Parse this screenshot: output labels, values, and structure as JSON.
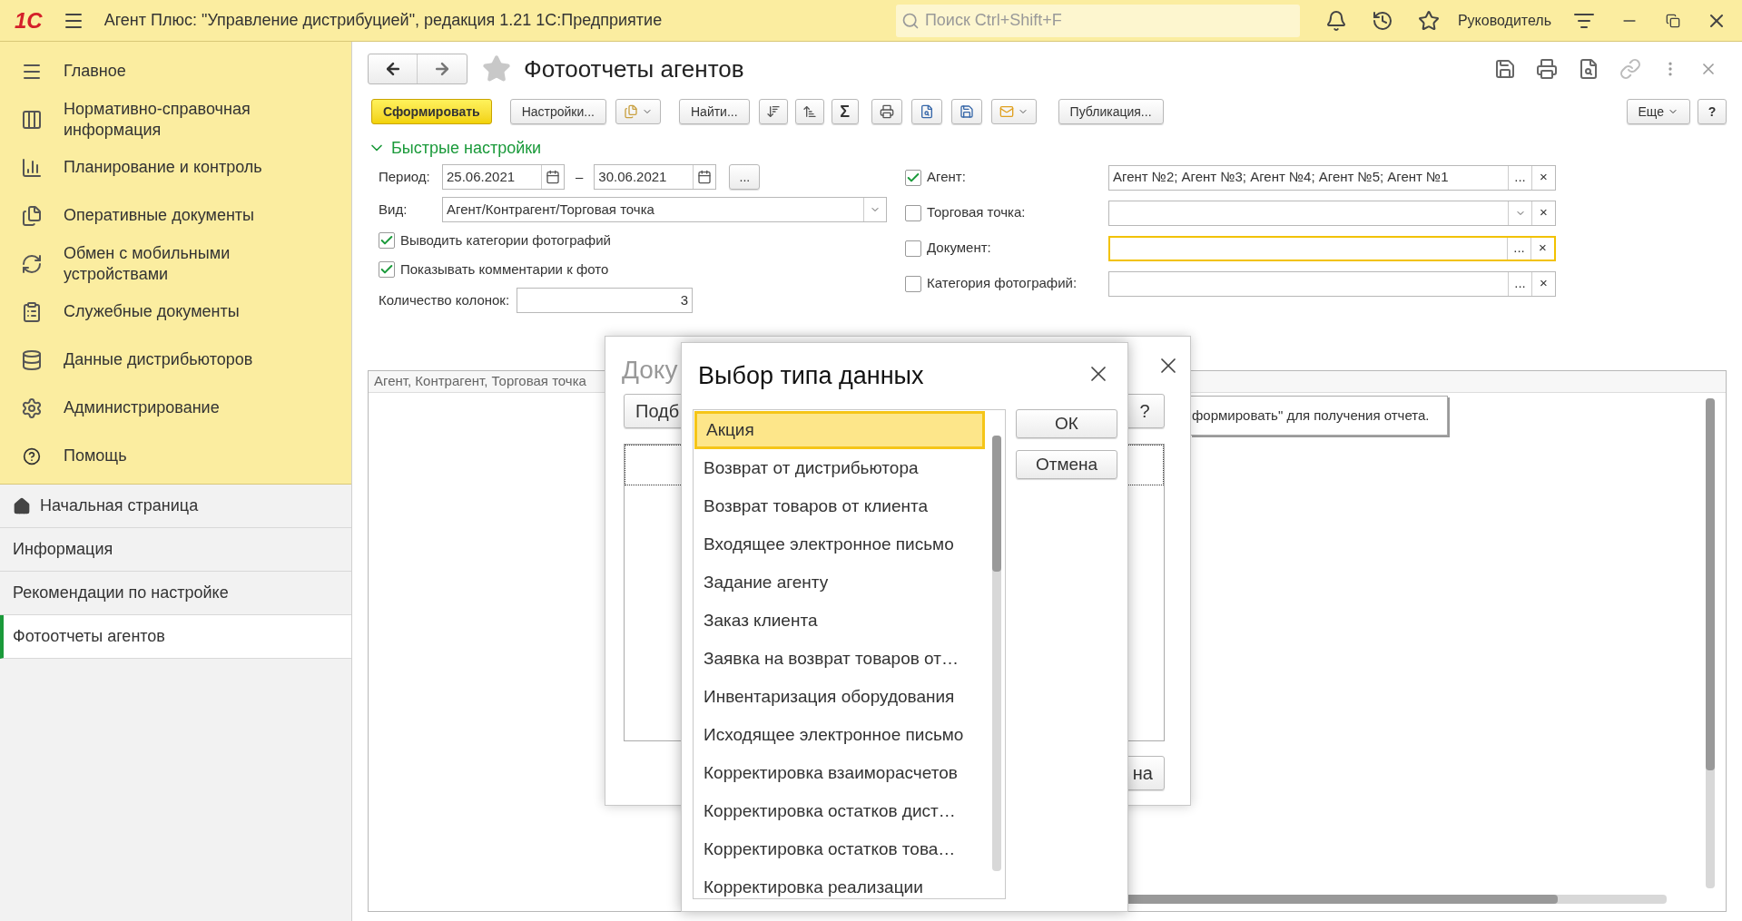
{
  "app_bar": {
    "logo": "1С",
    "title": "Агент Плюс: \"Управление дистрибуцией\", редакция 1.21 1С:Предприятие",
    "search": {
      "placeholder": "Поиск Ctrl+Shift+F"
    },
    "user": "Руководитель"
  },
  "sections": [
    {
      "label": "Главное"
    },
    {
      "label": "Нормативно-справочная информация"
    },
    {
      "label": "Планирование и контроль"
    },
    {
      "label": "Оперативные документы"
    },
    {
      "label": "Обмен с мобильными устройствами"
    },
    {
      "label": "Служебные документы"
    },
    {
      "label": "Данные дистрибьюторов"
    },
    {
      "label": "Администрирование"
    },
    {
      "label": "Помощь"
    }
  ],
  "open_pages": [
    {
      "label": "Начальная страница",
      "kind": "home",
      "selected": false
    },
    {
      "label": "Информация",
      "kind": "page",
      "selected": false
    },
    {
      "label": "Рекомендации по настройке",
      "kind": "page",
      "selected": false
    },
    {
      "label": "Фотоотчеты агентов",
      "kind": "page",
      "selected": true
    }
  ],
  "form": {
    "title": "Фотоотчеты агентов",
    "toolbar": [
      {
        "kind": "primary",
        "label": "Сформировать"
      },
      {
        "kind": "text",
        "label": "Настройки..."
      },
      {
        "kind": "variants"
      },
      {
        "kind": "text",
        "label": "Найти..."
      },
      {
        "kind": "sort-desc"
      },
      {
        "kind": "sort-asc"
      },
      {
        "kind": "text-icon",
        "label": "Σ"
      },
      {
        "kind": "print"
      },
      {
        "kind": "preview"
      },
      {
        "kind": "save"
      },
      {
        "kind": "mail"
      },
      {
        "kind": "text",
        "label": "Публикация..."
      }
    ],
    "more_button": "Еще",
    "help_button": "?",
    "quick_settings": {
      "title": "Быстрые настройки",
      "expanded": true,
      "period": {
        "label": "Период:",
        "from": "25.06.2021",
        "separator": "–",
        "to": "30.06.2021",
        "choose_button": "..."
      },
      "view": {
        "label": "Вид:",
        "value": "Агент/Контрагент/Торговая точка"
      },
      "options": [
        {
          "label": "Выводить категории фотографий",
          "checked": true
        },
        {
          "label": "Показывать комментарии к фото",
          "checked": true
        }
      ],
      "columns": {
        "label": "Количество колонок:",
        "value": "3"
      },
      "filters": [
        {
          "label": "Агент:",
          "checked": true,
          "kind": "choice",
          "value": "Агент №2; Агент №3; Агент №4; Агент №5; Агент №1",
          "focused": false,
          "choose_button": "...",
          "clear_button": "×"
        },
        {
          "label": "Торговая точка:",
          "checked": false,
          "kind": "dropdown",
          "focused": false,
          "clear_button": "×"
        },
        {
          "label": "Документ:",
          "checked": false,
          "kind": "choice",
          "focused": true,
          "choose_button": "...",
          "clear_button": "×"
        },
        {
          "label": "Категория фотографий:",
          "checked": false,
          "kind": "choice",
          "focused": false,
          "choose_button": "...",
          "clear_button": "×"
        }
      ]
    },
    "report": {
      "header": "Агент, Контрагент, Торговая точка",
      "message": "формировать\" для получения отчета."
    }
  },
  "back_dialog": {
    "title": "Доку",
    "pick_button": "Подб",
    "help_button": "?",
    "bottom_button": "на"
  },
  "type_dialog": {
    "title": "Выбор типа данных",
    "items": [
      {
        "label": "Акция",
        "selected": true
      },
      {
        "label": "Возврат от дистрибьютора",
        "selected": false
      },
      {
        "label": "Возврат товаров от клиента",
        "selected": false
      },
      {
        "label": "Входящее электронное письмо",
        "selected": false
      },
      {
        "label": "Задание агенту",
        "selected": false
      },
      {
        "label": "Заказ клиента",
        "selected": false
      },
      {
        "label": "Заявка на возврат товаров от…",
        "selected": false
      },
      {
        "label": "Инвентаризация оборудования",
        "selected": false
      },
      {
        "label": "Исходящее электронное письмо",
        "selected": false
      },
      {
        "label": "Корректировка взаиморасчетов",
        "selected": false
      },
      {
        "label": "Корректировка остатков дист…",
        "selected": false
      },
      {
        "label": "Корректировка остатков това…",
        "selected": false
      },
      {
        "label": "Корректировка реализации",
        "selected": false
      }
    ],
    "ok_button": "ОК",
    "cancel_button": "Отмена"
  }
}
